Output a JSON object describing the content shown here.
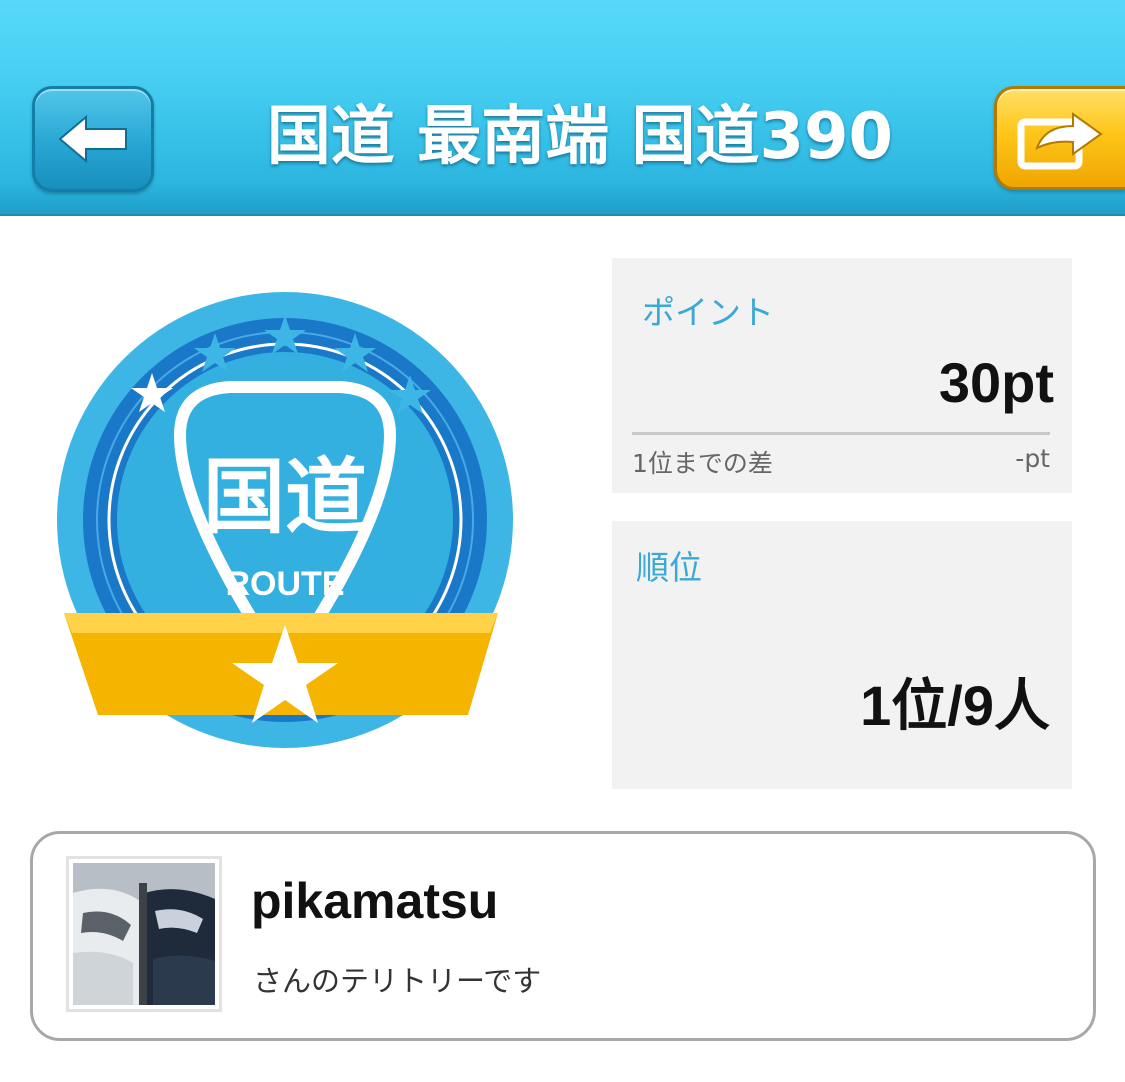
{
  "header": {
    "title": "国道 最南端 国道390",
    "back_icon": "back-arrow-icon",
    "share_icon": "share-arrow-icon"
  },
  "badge": {
    "main_text": "国道",
    "sub_text": "ROUTE",
    "colors": {
      "outer": "#3db6e6",
      "inner": "#1a78c9",
      "ribbon": "#f5b400"
    }
  },
  "points": {
    "label": "ポイント",
    "value": "30pt",
    "diff_label": "1位までの差",
    "diff_value": "-pt"
  },
  "rank": {
    "label": "順位",
    "value": "1位/9人"
  },
  "owner": {
    "username": "pikamatsu",
    "subtitle": "さんのテリトリーです",
    "avatar_icon": "car-photo"
  },
  "colors": {
    "header": "#45cdf1",
    "accent_label": "#3aa9d6",
    "share_button": "#ffc61a",
    "card_background": "#f2f2f2"
  }
}
